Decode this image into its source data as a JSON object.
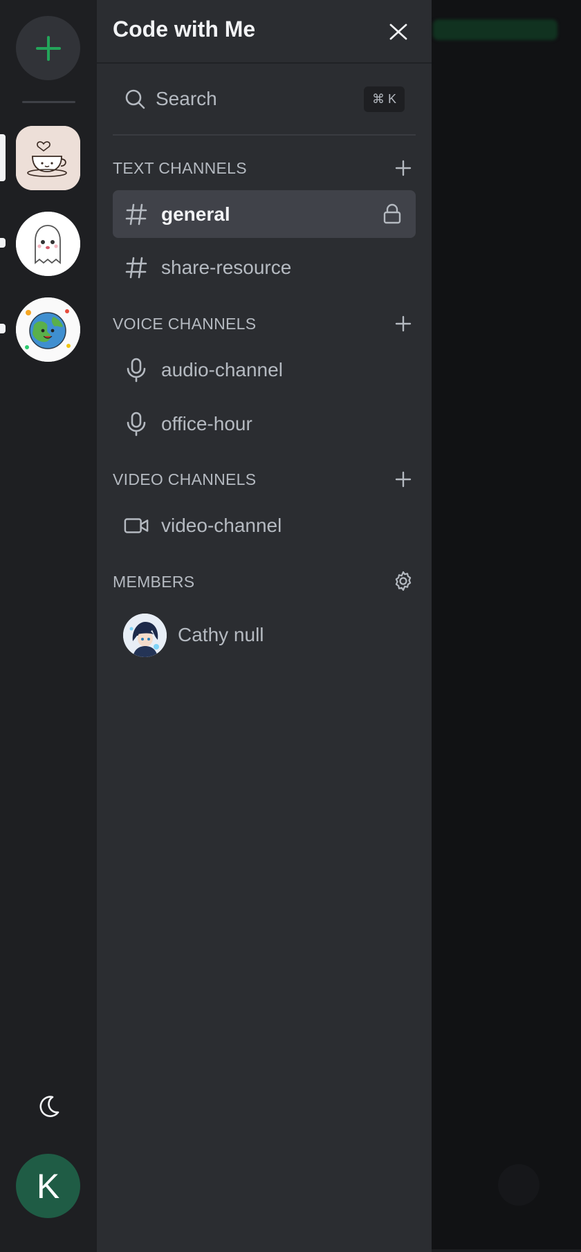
{
  "rail": {
    "add_server_icon": "plus-icon",
    "servers": [
      {
        "name": "coffee-cup-server",
        "active": true
      },
      {
        "name": "ghost-server",
        "active": false
      },
      {
        "name": "earth-server",
        "active": false
      }
    ],
    "theme_toggle_icon": "moon-icon",
    "user_initial": "K",
    "colors": {
      "accent": "#23a55a",
      "user_avatar_bg": "#1f5c45"
    }
  },
  "panel": {
    "server_name": "Code with Me",
    "close_icon": "close-icon",
    "search": {
      "label": "Search",
      "shortcut": "⌘ K"
    },
    "sections": {
      "text": {
        "title": "TEXT CHANNELS",
        "channels": [
          {
            "label": "general",
            "active": true,
            "locked": true
          },
          {
            "label": "share-resource",
            "active": false,
            "locked": false
          }
        ]
      },
      "voice": {
        "title": "VOICE CHANNELS",
        "channels": [
          {
            "label": "audio-channel"
          },
          {
            "label": "office-hour"
          }
        ]
      },
      "video": {
        "title": "VIDEO CHANNELS",
        "channels": [
          {
            "label": "video-channel"
          }
        ]
      },
      "members": {
        "title": "MEMBERS",
        "items": [
          {
            "name": "Cathy null"
          }
        ]
      }
    }
  }
}
